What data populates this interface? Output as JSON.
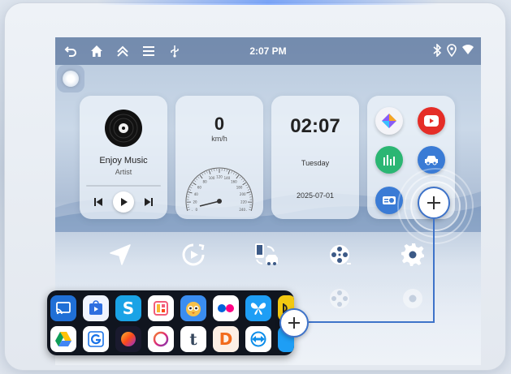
{
  "status_bar": {
    "time": "2:07 PM",
    "left_icons": [
      "back-icon",
      "home-icon",
      "double-chevron-up-icon",
      "menu-icon",
      "usb-icon"
    ],
    "right_icons": [
      "bluetooth-icon",
      "location-icon",
      "wifi-icon"
    ]
  },
  "music_widget": {
    "title": "Enjoy Music",
    "artist": "Artist",
    "controls": [
      "previous-icon",
      "play-icon",
      "next-icon"
    ]
  },
  "speed_widget": {
    "value": "0",
    "unit": "km/h",
    "gauge_ticks": [
      "0",
      "20",
      "40",
      "60",
      "80",
      "100",
      "120",
      "140",
      "160",
      "180",
      "200",
      "220",
      "240"
    ]
  },
  "clock_widget": {
    "time": "02:07",
    "day": "Tuesday",
    "date": "2025-07-01"
  },
  "app_widget": {
    "apps": [
      {
        "name": "gallery-app-icon",
        "color": "#e6e6ee"
      },
      {
        "name": "youtube-app-icon",
        "color": "#e52d27"
      },
      {
        "name": "equalizer-app-icon",
        "color": "#2bb673"
      },
      {
        "name": "car-app-icon",
        "color": "#3a7bd5"
      },
      {
        "name": "radio-app-icon",
        "color": "#3a7bd5"
      }
    ]
  },
  "dock": {
    "items": [
      "navigation-icon",
      "media-icon",
      "phone-link-icon",
      "video-reel-icon",
      "settings-icon"
    ]
  },
  "app_picker": {
    "row1": [
      {
        "name": "screen-cast-icon",
        "color": "#1f6fd6"
      },
      {
        "name": "play-store-icon",
        "color": "#2f6fe0"
      },
      {
        "name": "skype-icon",
        "color": "#1aa3e6"
      },
      {
        "name": "collage-icon",
        "color": "#f25c7a"
      },
      {
        "name": "owl-app-icon",
        "color": "#3a8df0"
      },
      {
        "name": "flickr-icon",
        "color": "#ffffff"
      },
      {
        "name": "butterfly-app-icon",
        "color": "#1e9ef5"
      },
      {
        "name": "yellow-app-icon",
        "color": "#f2c811"
      }
    ],
    "row2": [
      {
        "name": "google-drive-icon",
        "color": "#ffffff"
      },
      {
        "name": "g-app-icon",
        "color": "#ffffff"
      },
      {
        "name": "sphere-app-icon",
        "color": "#1a1a2e"
      },
      {
        "name": "ring-app-icon",
        "color": "#ffffff"
      },
      {
        "name": "tumblr-icon",
        "color": "#ffffff"
      },
      {
        "name": "d-app-icon",
        "color": "#fdf0e6"
      },
      {
        "name": "teamviewer-icon",
        "color": "#ffffff"
      },
      {
        "name": "partial-app-icon",
        "color": "#1e9ef5"
      }
    ]
  },
  "colors": {
    "accent": "#3e73c9",
    "status_bar": "#3c5a87"
  }
}
